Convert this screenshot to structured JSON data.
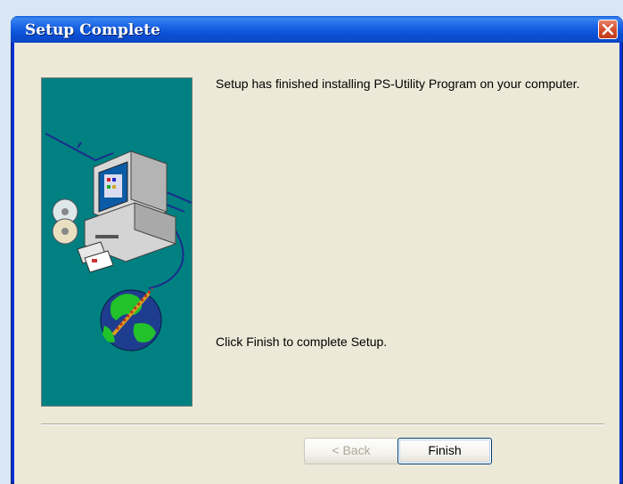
{
  "window": {
    "title": "Setup Complete"
  },
  "body": {
    "message_installed": "Setup has finished installing PS-Utility Program on your computer.",
    "message_finish": "Click Finish to complete Setup."
  },
  "buttons": {
    "back_label": "< Back",
    "finish_label": "Finish"
  },
  "icons": {
    "close": "close-icon",
    "illustration": "computer-install-illustration"
  },
  "colors": {
    "titlebar": "#0a50d4",
    "close_button": "#d5502f",
    "panel_bg": "#008080",
    "client_bg": "#ece9d8"
  }
}
